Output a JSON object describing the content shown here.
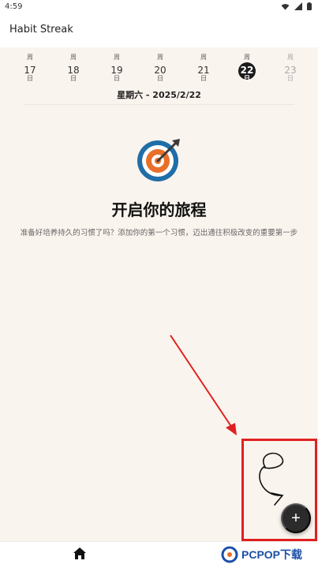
{
  "status_bar": {
    "time": "4:59",
    "icons": [
      "wifi-icon",
      "signal-icon",
      "battery-icon"
    ]
  },
  "app_bar": {
    "title": "Habit Streak"
  },
  "week_strip": {
    "days": [
      {
        "weekday": "周",
        "day": "17",
        "sub": "日",
        "state": "normal"
      },
      {
        "weekday": "周",
        "day": "18",
        "sub": "日",
        "state": "normal"
      },
      {
        "weekday": "周",
        "day": "19",
        "sub": "日",
        "state": "normal"
      },
      {
        "weekday": "周",
        "day": "20",
        "sub": "日",
        "state": "normal"
      },
      {
        "weekday": "周",
        "day": "21",
        "sub": "日",
        "state": "normal"
      },
      {
        "weekday": "周",
        "day": "22",
        "sub": "日",
        "state": "selected"
      },
      {
        "weekday": "周",
        "day": "23",
        "sub": "日",
        "state": "dim"
      }
    ],
    "selected_date_label": "星期六 - 2025/2/22"
  },
  "empty_state": {
    "icon": "target-dart-icon",
    "title": "开启你的旅程",
    "description": "准备好培养持久的习惯了吗？添加你的第一个习惯，迈出通往积极改变的重要第一步"
  },
  "fab": {
    "label": "+",
    "icon": "plus-icon"
  },
  "bottom_nav": {
    "items": [
      {
        "icon": "home-icon"
      }
    ]
  },
  "watermark": {
    "text": "PCPOP下载"
  },
  "colors": {
    "background": "#faf4ee",
    "selected_day": "#1c1c1c",
    "fab": "#2b2b2b",
    "annotation_red": "#e02020",
    "target_blue": "#1f6ea8",
    "target_orange": "#e8702a"
  }
}
